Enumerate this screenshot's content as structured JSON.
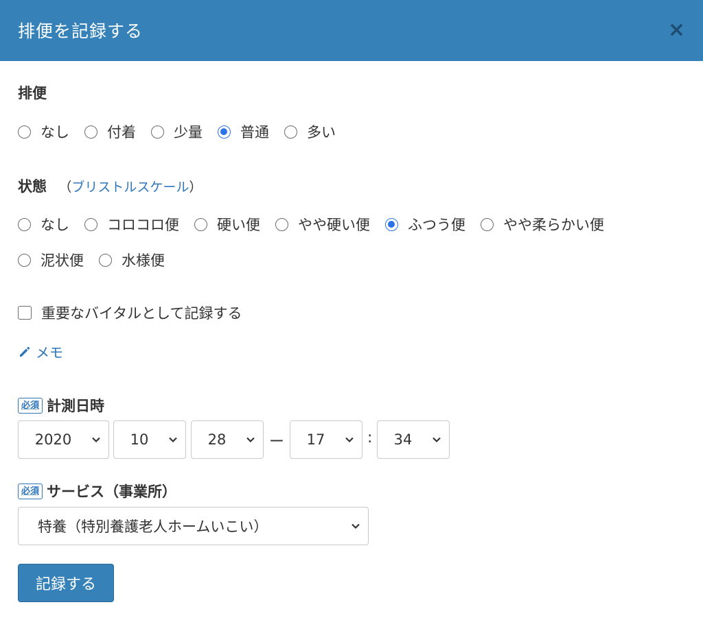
{
  "modal": {
    "title": "排便を記録する",
    "close_label": "×"
  },
  "stool": {
    "label": "排便",
    "options": [
      "なし",
      "付着",
      "少量",
      "普通",
      "多い"
    ],
    "selected": "普通"
  },
  "condition": {
    "label": "状態",
    "paren_open": "（",
    "link_text": "ブリストルスケール",
    "paren_close": "）",
    "options": [
      "なし",
      "コロコロ便",
      "硬い便",
      "やや硬い便",
      "ふつう便",
      "やや柔らかい便",
      "泥状便",
      "水様便"
    ],
    "selected": "ふつう便"
  },
  "important": {
    "label": "重要なバイタルとして記録する",
    "checked": false
  },
  "memo": {
    "label": "メモ"
  },
  "datetime": {
    "badge": "必須",
    "label": "計測日時",
    "year": "2020",
    "month": "10",
    "day": "28",
    "separator": "ー",
    "hour": "17",
    "colon": ":",
    "minute": "34"
  },
  "service": {
    "badge": "必須",
    "label": "サービス（事業所）",
    "selected": "特養（特別養護老人ホームいこい）"
  },
  "submit": {
    "label": "記録する"
  },
  "colors": {
    "header": "#3682b8",
    "link": "#2f76ba",
    "radio_checked": "#2a73e8"
  }
}
